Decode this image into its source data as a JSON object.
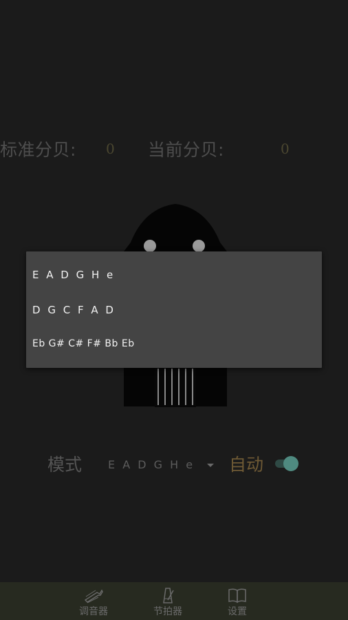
{
  "decibel": {
    "standard_label": "标准分贝:",
    "standard_value": "0",
    "current_label": "当前分贝:",
    "current_value": "0"
  },
  "mode": {
    "label": "模式",
    "selected": "E A D G H e",
    "auto_label": "自动",
    "auto_enabled": true
  },
  "dropdown": {
    "options": [
      "E A D G H e",
      "D G C F A D",
      "Eb G# C# F# Bb Eb"
    ]
  },
  "nav": {
    "items": [
      {
        "label": "调音器",
        "icon": "guitar-tuner-icon"
      },
      {
        "label": "节拍器",
        "icon": "metronome-icon"
      },
      {
        "label": "设置",
        "icon": "book-icon"
      }
    ]
  },
  "colors": {
    "background": "#1b1b1b",
    "popup": "#444444",
    "accent_toggle": "#4f8a80",
    "auto_label": "#6f5a35",
    "nav_bar": "#272a20"
  }
}
